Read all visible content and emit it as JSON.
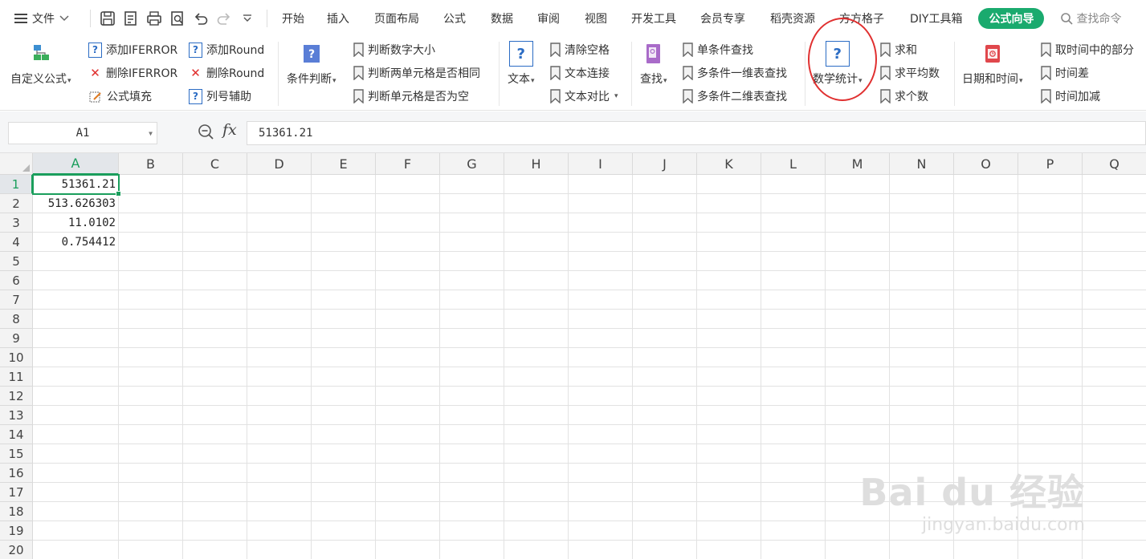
{
  "menubar": {
    "file_label": "文件",
    "tabs": [
      "开始",
      "插入",
      "页面布局",
      "公式",
      "数据",
      "审阅",
      "视图",
      "开发工具",
      "会员专享",
      "稻壳资源",
      "方方格子",
      "DIY工具箱"
    ],
    "active_tab": "公式向导",
    "search_label": "查找命令"
  },
  "ribbon": {
    "custom_formula": "自定义公式",
    "add_iferror": "添加IFERROR",
    "del_iferror": "删除IFERROR",
    "formula_fill": "公式填充",
    "add_round": "添加Round",
    "del_round": "删除Round",
    "col_assist": "列号辅助",
    "condition": "条件判断",
    "judge_size": "判断数字大小",
    "judge_same": "判断两单元格是否相同",
    "judge_empty": "判断单元格是否为空",
    "text": "文本",
    "clear_space": "清除空格",
    "text_join": "文本连接",
    "text_compare": "文本对比",
    "lookup": "查找",
    "single_lookup": "单条件查找",
    "multi_1d": "多条件一维表查找",
    "multi_2d": "多条件二维表查找",
    "math_stat": "数学统计",
    "sum": "求和",
    "average": "求平均数",
    "count": "求个数",
    "datetime": "日期和时间",
    "time_part": "取时间中的部分",
    "time_diff": "时间差",
    "time_add": "时间加减"
  },
  "formula_bar": {
    "name_box": "A1",
    "fx_label": "fx",
    "value": "51361.21"
  },
  "sheet": {
    "columns": [
      "A",
      "B",
      "C",
      "D",
      "E",
      "F",
      "G",
      "H",
      "I",
      "J",
      "K",
      "L",
      "M",
      "N",
      "O",
      "P",
      "Q"
    ],
    "rows": [
      "1",
      "2",
      "3",
      "4",
      "5",
      "6",
      "7",
      "8",
      "9",
      "10",
      "11",
      "12",
      "13",
      "14",
      "15",
      "16",
      "17",
      "18",
      "19",
      "20"
    ],
    "cells": {
      "A1": "51361.21",
      "A2": "513.626303",
      "A3": "11.0102",
      "A4": "0.754412"
    }
  },
  "watermark": {
    "line1": "Bai du 经验",
    "line2": "jingyan.baidu.com"
  },
  "colors": {
    "accent_green": "#1aaa6e",
    "question_blue": "#2b6cc4",
    "highlight_circle": "#e03030",
    "delete_red": "#e0302f"
  }
}
